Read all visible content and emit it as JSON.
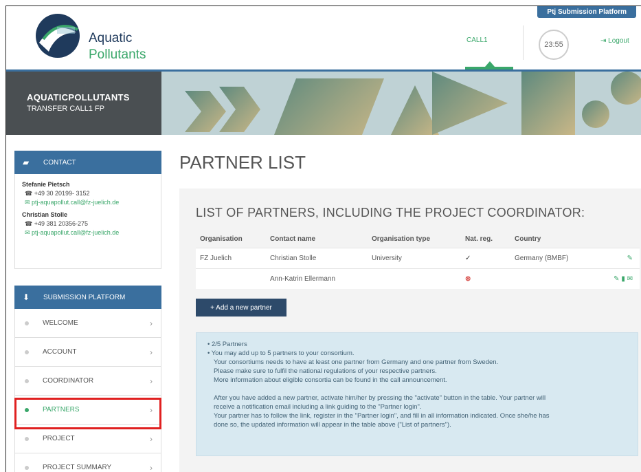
{
  "header": {
    "platform_label": "Ptj Submission Platform",
    "logo_line1": "Aquatic",
    "logo_line2": "Pollutants",
    "nav_call": "CALL1",
    "timer": "23:55",
    "logout": "Logout"
  },
  "banner": {
    "title": "AQUATICPOLLUTANTS",
    "subtitle": "TRANSFER CALL1 FP"
  },
  "contact": {
    "heading": "CONTACT",
    "people": [
      {
        "name": "Stefanie Pietsch",
        "phone": "+49 30 20199- 3152",
        "email": "ptj-aquapollut.call@fz-juelich.de"
      },
      {
        "name": "Christian Stolle",
        "phone": "+49 381 20356-275",
        "email": "ptj-aquapollut.call@fz-juelich.de"
      }
    ]
  },
  "submission": {
    "heading": "SUBMISSION PLATFORM",
    "items": [
      {
        "label": "WELCOME"
      },
      {
        "label": "ACCOUNT"
      },
      {
        "label": "COORDINATOR"
      },
      {
        "label": "PARTNERS"
      },
      {
        "label": "PROJECT"
      },
      {
        "label": "PROJECT SUMMARY"
      }
    ]
  },
  "main": {
    "title": "PARTNER LIST",
    "list_title": "LIST OF PARTNERS, INCLUDING THE PROJECT COORDINATOR:",
    "columns": [
      "Organisation",
      "Contact name",
      "Organisation type",
      "Nat. reg.",
      "Country"
    ],
    "rows": [
      {
        "organisation": "FZ Juelich",
        "contact": "Christian Stolle",
        "type": "University",
        "natreg": "✓",
        "country": "Germany (BMBF)"
      },
      {
        "organisation": "",
        "contact": "Ann-Katrin Ellermann",
        "type": "",
        "natreg": "⊗",
        "country": ""
      }
    ],
    "add_button": "+ Add a new partner",
    "info": {
      "bullet1": "• 2/5 Partners",
      "bullet2": "• You may add up to 5 partners to your consortium.",
      "line1": "Your consortiums needs to have at least one partner from Germany and one partner from Sweden.",
      "line2": "Please make sure to fulfil the national regulations of your respective partners.",
      "line3": "More information about eligible consortia can be found in the call announcement.",
      "line4": "After you have added a new partner, activate him/her by pressing the \"activate\" button in the table. Your partner will",
      "line5": "receive a notification email including a link guiding to the \"Partner login\".",
      "line6": "Your partner has to follow the link, register in the \"Partner login\", and fill in all information indicated. Once she/he has",
      "line7": "done so, the updated information will appear in the table above (\"List of partners\")."
    }
  }
}
